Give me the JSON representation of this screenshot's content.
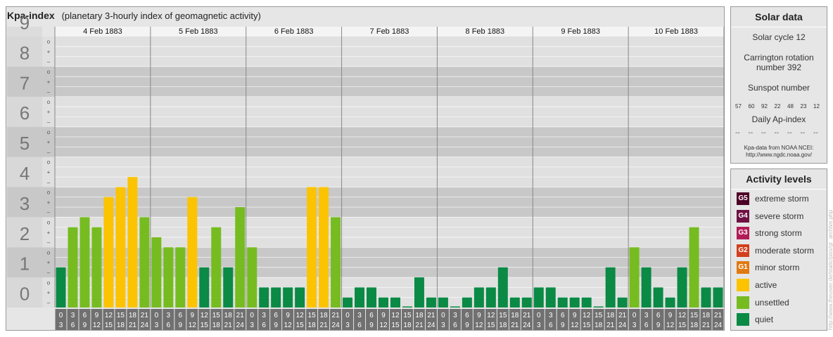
{
  "header": {
    "title": "Kpa-index",
    "subtitle": "(planetary 3-hourly index of geomagnetic activity)"
  },
  "chart_data": {
    "type": "bar",
    "ylim": [
      0,
      9
    ],
    "y_ticks": [
      "0",
      "1",
      "2",
      "3",
      "4",
      "5",
      "6",
      "7",
      "8",
      "9"
    ],
    "sub_ticks": [
      "–",
      "+",
      "o"
    ],
    "days": [
      "4 Feb 1883",
      "5 Feb 1883",
      "6 Feb 1883",
      "7 Feb 1883",
      "8 Feb 1883",
      "9 Feb 1883",
      "10 Feb 1883"
    ],
    "interval_labels": [
      [
        "0",
        "3"
      ],
      [
        "3",
        "6"
      ],
      [
        "6",
        "9"
      ],
      [
        "9",
        "12"
      ],
      [
        "12",
        "15"
      ],
      [
        "15",
        "18"
      ],
      [
        "18",
        "21"
      ],
      [
        "21",
        "24"
      ]
    ],
    "values": [
      [
        1.333,
        2.667,
        3.0,
        2.667,
        3.667,
        4.0,
        4.333,
        3.0
      ],
      [
        2.333,
        2.0,
        2.0,
        3.667,
        1.333,
        2.667,
        1.333,
        3.333
      ],
      [
        2.0,
        0.667,
        0.667,
        0.667,
        0.667,
        4.0,
        4.0,
        3.0
      ],
      [
        0.333,
        0.667,
        0.667,
        0.333,
        0.333,
        0.0,
        1.0,
        0.333
      ],
      [
        0.333,
        0.0,
        0.333,
        0.667,
        0.667,
        1.333,
        0.333,
        0.333
      ],
      [
        0.667,
        0.667,
        0.333,
        0.333,
        0.333,
        0.0,
        1.333,
        0.333
      ],
      [
        2.0,
        1.333,
        0.667,
        0.333,
        1.333,
        2.667,
        0.667,
        0.667
      ]
    ],
    "level_colors": {
      "quiet": "#0a8a45",
      "unsettled": "#76bc21",
      "active": "#fcc300"
    }
  },
  "solar": {
    "heading": "Solar data",
    "cycle": "Solar cycle 12",
    "carrington_1": "Carrington rotation",
    "carrington_2": "number 392",
    "sunspot_heading": "Sunspot number",
    "sunspot_values": [
      "57",
      "60",
      "92",
      "22",
      "48",
      "23",
      "12"
    ],
    "ap_heading": "Daily Ap-index",
    "ap_values": [
      "--",
      "--",
      "--",
      "--",
      "--",
      "--",
      "--"
    ],
    "source_1": "Kpa-data from NOAA NCEI:",
    "source_2": "http://www.ngdc.noaa.gov/"
  },
  "activity": {
    "heading": "Activity levels",
    "levels": [
      {
        "code": "G5",
        "label": "extreme storm",
        "color": "#4d0026"
      },
      {
        "code": "G4",
        "label": "severe storm",
        "color": "#6e1044"
      },
      {
        "code": "G3",
        "label": "strong storm",
        "color": "#b21c56"
      },
      {
        "code": "G2",
        "label": "moderate storm",
        "color": "#d2401c"
      },
      {
        "code": "G1",
        "label": "minor storm",
        "color": "#e07a13"
      },
      {
        "code": "",
        "label": "active",
        "color": "#fcc300"
      },
      {
        "code": "",
        "label": "unsettled",
        "color": "#76bc21"
      },
      {
        "code": "",
        "label": "quiet",
        "color": "#0a8a45"
      }
    ]
  },
  "watermark": "http://www.theusen.de/static/pixx/gr_archive.php"
}
